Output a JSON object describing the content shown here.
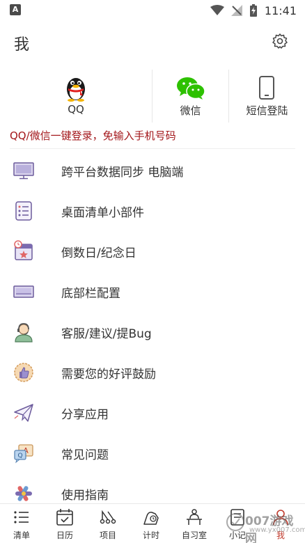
{
  "status_bar": {
    "left_icon": "A",
    "time": "11:41",
    "icons": [
      "wifi-icon",
      "no-signal-icon",
      "battery-charging-icon"
    ]
  },
  "header": {
    "title": "我",
    "settings_icon": "gear-icon"
  },
  "login": {
    "options": [
      {
        "label": "QQ",
        "icon": "qq-penguin-icon"
      },
      {
        "label": "微信",
        "icon": "wechat-icon"
      },
      {
        "label": "短信登陆",
        "icon": "phone-icon"
      }
    ],
    "hint": "QQ/微信一键登录，免输入手机号码"
  },
  "menu": [
    {
      "label": "跨平台数据同步 电脑端",
      "icon": "monitor-icon"
    },
    {
      "label": "桌面清单小部件",
      "icon": "checklist-widget-icon"
    },
    {
      "label": "倒数日/纪念日",
      "icon": "calendar-star-icon"
    },
    {
      "label": "底部栏配置",
      "icon": "bottom-bar-icon"
    },
    {
      "label": "客服/建议/提Bug",
      "icon": "support-agent-icon"
    },
    {
      "label": "需要您的好评鼓励",
      "icon": "thumbs-up-icon"
    },
    {
      "label": "分享应用",
      "icon": "paper-plane-icon"
    },
    {
      "label": "常见问题",
      "icon": "faq-icon"
    },
    {
      "label": "使用指南",
      "icon": "guide-icon"
    }
  ],
  "tabbar": [
    {
      "label": "清单",
      "icon": "list-icon"
    },
    {
      "label": "日历",
      "icon": "calendar-icon"
    },
    {
      "label": "项目",
      "icon": "project-icon"
    },
    {
      "label": "计时",
      "icon": "timer-icon"
    },
    {
      "label": "自习室",
      "icon": "study-room-icon"
    },
    {
      "label": "小记",
      "icon": "note-icon"
    },
    {
      "label": "我",
      "icon": "me-icon"
    }
  ],
  "watermark": {
    "text": "007游戏网",
    "sub": "www.yx007.com"
  },
  "colors": {
    "hint_red": "#a3171b",
    "accent_red": "#c0392b",
    "wechat_green": "#2dc100",
    "icon_purple": "#6c5b9c"
  }
}
